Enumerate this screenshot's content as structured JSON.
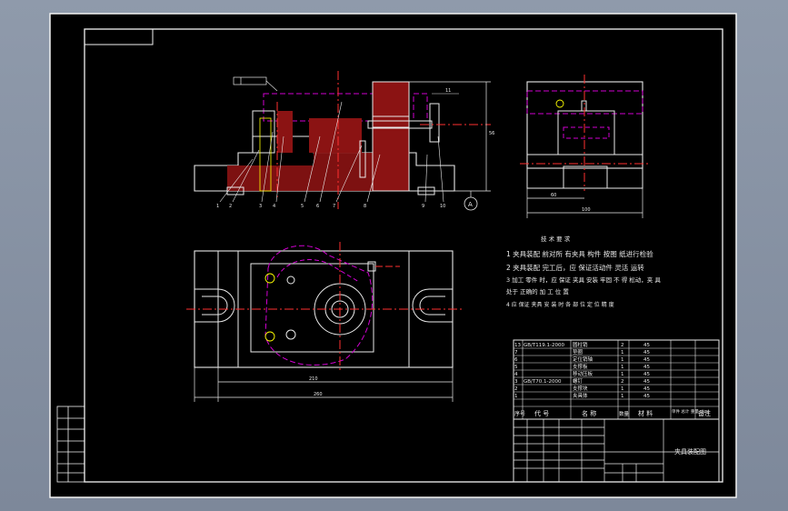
{
  "drawing": {
    "part_labels": [
      "1",
      "2",
      "3",
      "4",
      "5",
      "6",
      "7",
      "8",
      "9",
      "10",
      "11"
    ],
    "section_tag": "A",
    "front_dims": {
      "height": "56"
    },
    "side_dims": {
      "inner": "60",
      "outer": "100"
    },
    "plan_dims": {
      "inner": "210",
      "outer": "260"
    },
    "tech_req": {
      "title": "技 术 要 求",
      "items": [
        "1  夹具装配 前对所 有夹具 构件 按图 纸进行检验",
        "2  夹具装配 完工后，应 保证活动件 灵活 运转",
        "3  加工 零件 时，应 保证 夹具 安装 牢固 不 得 松动，夹 具",
        "   处于 正确的 加 工 位 置",
        "4  应 保证 夹具 安 装 时 各 部 位 定 位 精 度"
      ]
    },
    "bom": {
      "rows": [
        {
          "no": "13",
          "code": "GB/T119.1-2000",
          "name": "圆柱销",
          "qty": "2",
          "mat": "45"
        },
        {
          "no": "7",
          "code": "",
          "name": "垫圈",
          "qty": "1",
          "mat": "45"
        },
        {
          "no": "6",
          "code": "",
          "name": "定位销轴",
          "qty": "1",
          "mat": "45"
        },
        {
          "no": "5",
          "code": "",
          "name": "支撑板",
          "qty": "1",
          "mat": "45"
        },
        {
          "no": "4",
          "code": "",
          "name": "移动压板",
          "qty": "1",
          "mat": "45"
        },
        {
          "no": "3",
          "code": "GB/T70.1-2000",
          "name": "螺钉",
          "qty": "2",
          "mat": "45"
        },
        {
          "no": "2",
          "code": "",
          "name": "支撑块",
          "qty": "1",
          "mat": "45"
        },
        {
          "no": "1",
          "code": "",
          "name": "夹具体",
          "qty": "1",
          "mat": "45"
        }
      ],
      "header": {
        "no": "序号",
        "code": "代 号",
        "name": "名 称",
        "qty": "数量",
        "mat": "材 料",
        "weight": "单件 总计 重量（kg）",
        "note": "备注"
      }
    },
    "title_block": {
      "title": "夹具装配图"
    }
  }
}
